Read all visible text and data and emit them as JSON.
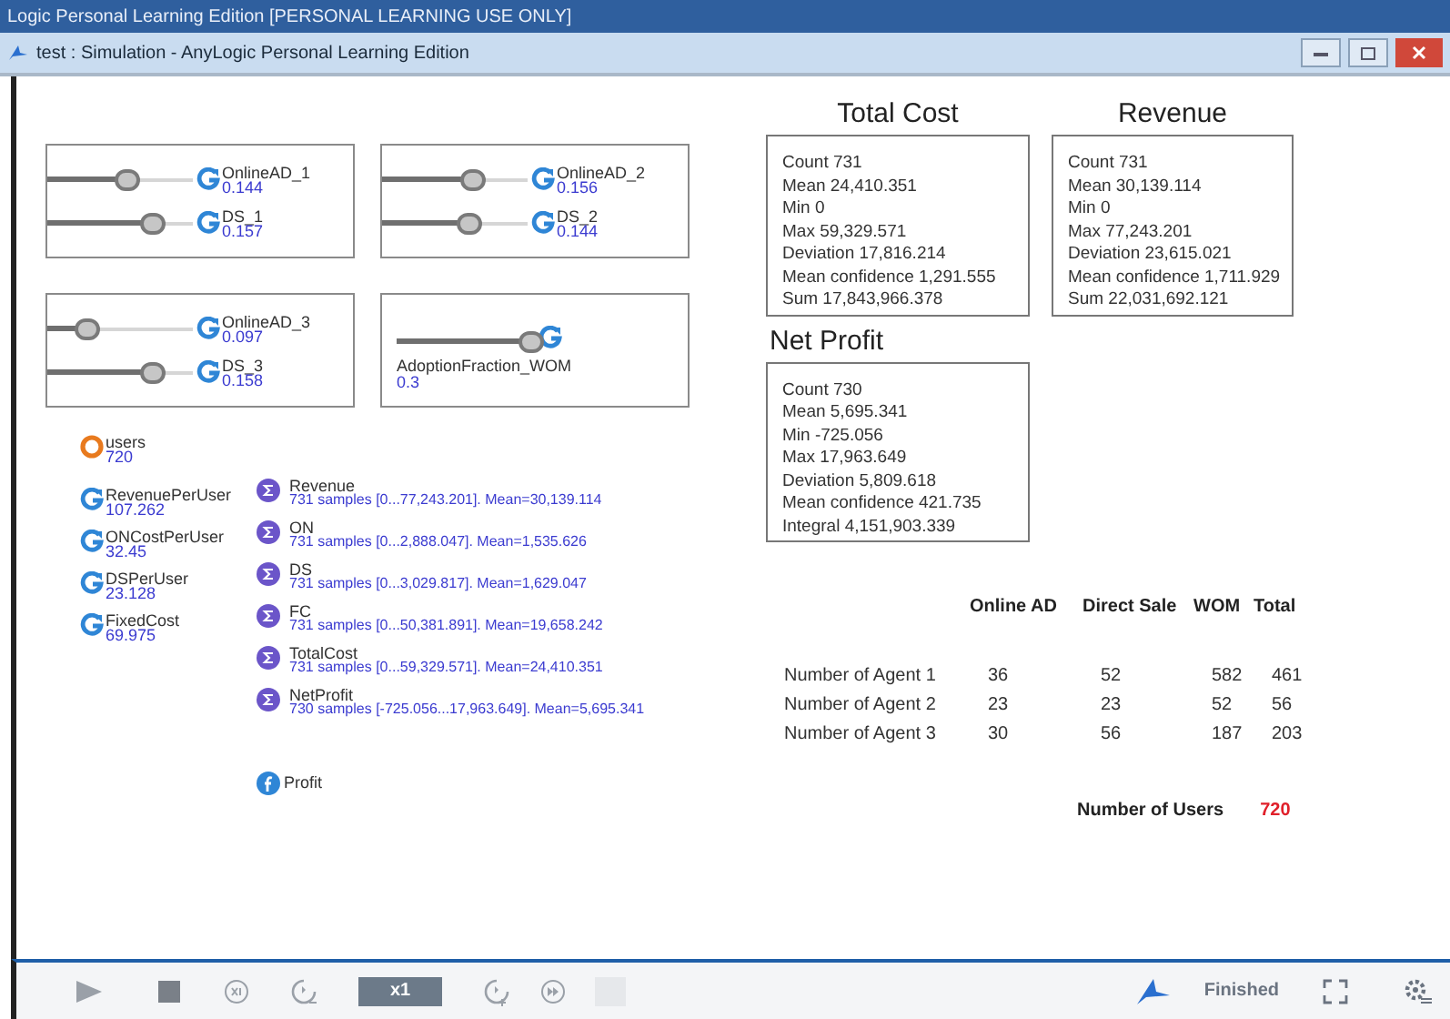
{
  "app_title": "Logic Personal Learning Edition [PERSONAL LEARNING USE ONLY]",
  "window": {
    "title": "test : Simulation - AnyLogic Personal Learning Edition"
  },
  "slider_panels": [
    {
      "sliders": [
        {
          "kind": "inline",
          "name": "OnlineAD_1",
          "value": "0.144",
          "level": 0.55
        },
        {
          "kind": "inline",
          "name": "DS_1",
          "value": "0.157",
          "level": 0.72
        }
      ]
    },
    {
      "sliders": [
        {
          "kind": "inline",
          "name": "OnlineAD_2",
          "value": "0.156",
          "level": 0.62
        },
        {
          "kind": "inline",
          "name": "DS_2",
          "value": "0.144",
          "level": 0.6
        }
      ]
    },
    {
      "sliders": [
        {
          "kind": "inline",
          "name": "OnlineAD_3",
          "value": "0.097",
          "level": 0.28
        },
        {
          "kind": "inline",
          "name": "DS_3",
          "value": "0.158",
          "level": 0.72
        }
      ]
    },
    {
      "sliders": [
        {
          "kind": "caption",
          "name": "AdoptionFraction_WOM",
          "value": "0.3",
          "level": 0.92
        }
      ]
    }
  ],
  "variables": [
    {
      "kind": "variable",
      "name": "users",
      "value": "720"
    },
    {
      "kind": "parameter",
      "name": "RevenuePerUser",
      "value": "107.262"
    },
    {
      "kind": "parameter",
      "name": "ONCostPerUser",
      "value": "32.45"
    },
    {
      "kind": "parameter",
      "name": "DSPerUser",
      "value": "23.128"
    },
    {
      "kind": "parameter",
      "name": "FixedCost",
      "value": "69.975"
    }
  ],
  "datasets": [
    {
      "name": "Revenue",
      "summary": "731 samples [0...77,243.201]. Mean=30,139.114"
    },
    {
      "name": "ON",
      "summary": "731 samples [0...2,888.047]. Mean=1,535.626"
    },
    {
      "name": "DS",
      "summary": "731 samples [0...3,029.817]. Mean=1,629.047"
    },
    {
      "name": "FC",
      "summary": "731 samples [0...50,381.891]. Mean=19,658.242"
    },
    {
      "name": "TotalCost",
      "summary": "731 samples [0...59,329.571]. Mean=24,410.351"
    },
    {
      "name": "NetProfit",
      "summary": "730 samples [-725.056...17,963.649]. Mean=5,695.341"
    }
  ],
  "function": {
    "name": "Profit"
  },
  "stat_boxes": [
    {
      "title": "Total Cost",
      "lines": [
        "Count 731",
        "Mean 24,410.351",
        "Min 0",
        "Max 59,329.571",
        "Deviation 17,816.214",
        "Mean confidence 1,291.555",
        "Sum 17,843,966.378"
      ]
    },
    {
      "title": "Revenue",
      "lines": [
        "Count 731",
        "Mean 30,139.114",
        "Min 0",
        "Max 77,243.201",
        "Deviation 23,615.021",
        "Mean confidence 1,711.929",
        "Sum 22,031,692.121"
      ]
    },
    {
      "title": "Net Profit",
      "lines": [
        "Count 730",
        "Mean 5,695.341",
        "Min -725.056",
        "Max 17,963.649",
        "Deviation 5,809.618",
        "Mean confidence 421.735",
        "Integral 4,151,903.339"
      ]
    }
  ],
  "table": {
    "columns": [
      "Online AD",
      "Direct Sale",
      "WOM",
      "Total"
    ],
    "rows": [
      {
        "label": "Number of Agent 1",
        "cells": [
          "36",
          "52",
          "582",
          "461"
        ]
      },
      {
        "label": "Number of Agent 2",
        "cells": [
          "23",
          "23",
          "52",
          "56"
        ]
      },
      {
        "label": "Number of Agent 3",
        "cells": [
          "30",
          "56",
          "187",
          "203"
        ]
      }
    ]
  },
  "users_total": {
    "label": "Number of Users",
    "value": "720"
  },
  "toolbar": {
    "speed": "x1",
    "status": "Finished"
  }
}
